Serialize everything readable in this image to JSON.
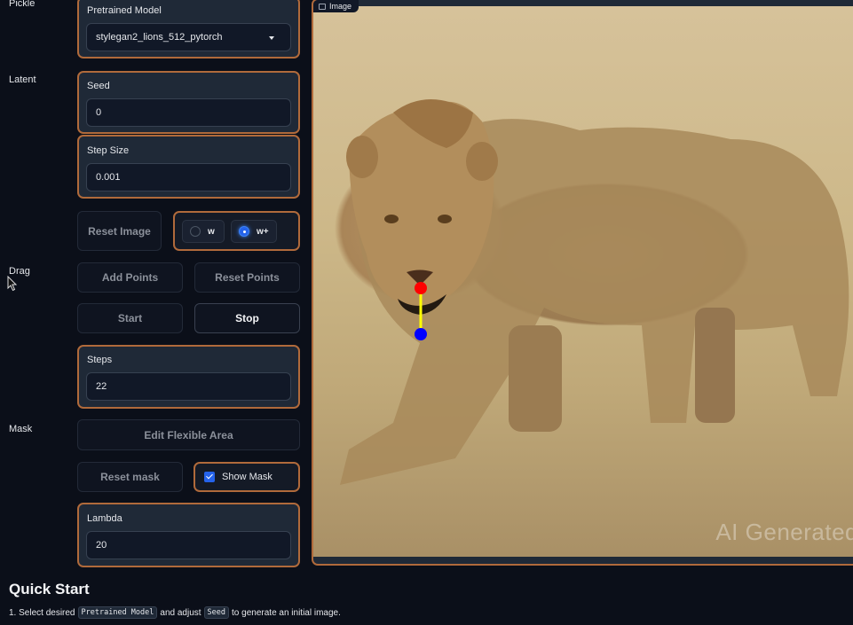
{
  "sections": {
    "pickle": "Pickle",
    "latent": "Latent",
    "drag": "Drag",
    "mask": "Mask"
  },
  "pretrained_model": {
    "label": "Pretrained Model",
    "value": "stylegan2_lions_512_pytorch"
  },
  "seed": {
    "label": "Seed",
    "value": "0"
  },
  "step_size": {
    "label": "Step Size",
    "value": "0.001"
  },
  "buttons": {
    "reset_image": "Reset Image",
    "add_points": "Add Points",
    "reset_points": "Reset Points",
    "start": "Start",
    "stop": "Stop",
    "edit_flexible_area": "Edit Flexible Area",
    "reset_mask": "Reset mask"
  },
  "latent_space": {
    "options": [
      "w",
      "w+"
    ],
    "selected": "w+"
  },
  "steps": {
    "label": "Steps",
    "value": "22"
  },
  "show_mask": {
    "label": "Show Mask",
    "checked": true
  },
  "lambda": {
    "label": "Lambda",
    "value": "20"
  },
  "image_panel": {
    "label": "Image",
    "watermark": "AI Generated",
    "handle_point_color": "#ff0000",
    "target_point_color": "#0000ff",
    "drag_line_color": "#ffff00"
  },
  "quick_start": {
    "title": "Quick Start",
    "step1_prefix": "1. Select desired",
    "step1_code1": "Pretrained Model",
    "step1_middle": "and adjust",
    "step1_code2": "Seed",
    "step1_suffix": "to generate an initial image."
  },
  "colors": {
    "accent_border": "#b06a3b",
    "panel_bg": "#1f2937",
    "page_bg": "#0b0f19",
    "radio_active": "#2563eb"
  }
}
